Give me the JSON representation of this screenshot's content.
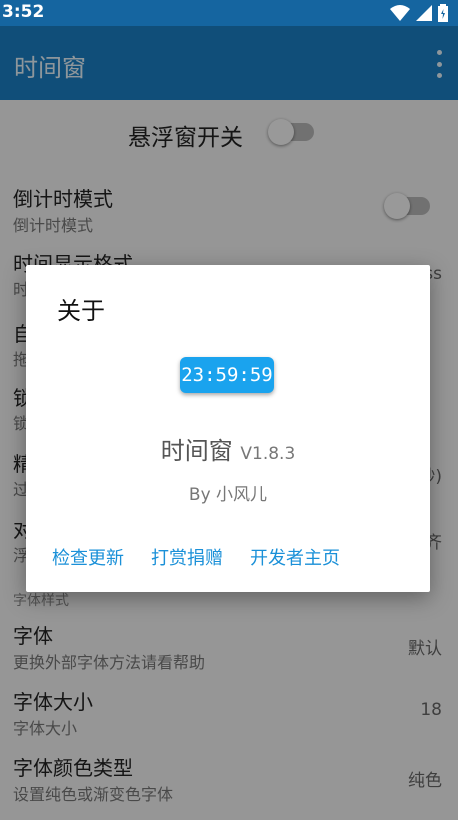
{
  "status": {
    "time": "3:52"
  },
  "appbar": {
    "title": "时间窗"
  },
  "settings": {
    "floating_window_toggle": "悬浮窗开关",
    "countdown": {
      "title": "倒计时模式",
      "subtitle": "倒计时模式"
    },
    "time_format": {
      "title": "时间显示格式",
      "subtitle_partial": "时",
      "value_partial": "ss"
    },
    "row_auto_partial": {
      "title": "自",
      "subtitle": "拖"
    },
    "row_lock_partial": {
      "title": "锁",
      "subtitle": "锁"
    },
    "row_precision_partial": {
      "title": "精",
      "subtitle": "过",
      "value_partial": "秒)"
    },
    "row_align_partial": {
      "title": "对",
      "subtitle": "浮",
      "value_partial": "齐"
    },
    "section_font_style": "字体样式",
    "font": {
      "title": "字体",
      "subtitle": "更换外部字体方法请看帮助",
      "value": "默认"
    },
    "font_size": {
      "title": "字体大小",
      "subtitle": "字体大小",
      "value": "18"
    },
    "font_color_type": {
      "title": "字体颜色类型",
      "subtitle": "设置纯色或渐变色字体",
      "value": "纯色"
    }
  },
  "dialog": {
    "title": "关于",
    "clock": "23:59:59",
    "app_name": "时间窗",
    "version": "V1.8.3",
    "author": "By 小风儿",
    "buttons": [
      "检查更新",
      "打赏捐赠",
      "开发者主页"
    ]
  },
  "colors": {
    "primary": "#1a7fc4",
    "status": "#1565a0",
    "accent": "#1a90d8",
    "clock_bg": "#1aa3ee"
  },
  "icons": [
    "wifi-icon",
    "signal-icon",
    "battery-icon",
    "overflow-menu-icon"
  ]
}
